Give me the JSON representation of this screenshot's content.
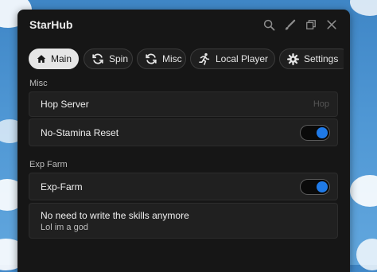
{
  "window": {
    "title": "StarHub"
  },
  "tabs": [
    {
      "label": "Main",
      "icon": "home-icon",
      "active": true
    },
    {
      "label": "Spin",
      "icon": "refresh-icon",
      "active": false
    },
    {
      "label": "Misc",
      "icon": "refresh-icon",
      "active": false
    },
    {
      "label": "Local Player",
      "icon": "running-person-icon",
      "active": false
    },
    {
      "label": "Settings",
      "icon": "gear-icon",
      "active": false
    }
  ],
  "sections": {
    "misc": {
      "label": "Misc",
      "hop_server": {
        "label": "Hop Server",
        "hint": "Hop"
      },
      "no_stamina": {
        "label": "No-Stamina Reset",
        "enabled": true
      }
    },
    "exp_farm": {
      "label": "Exp Farm",
      "exp_farm_toggle": {
        "label": "Exp-Farm",
        "enabled": true
      },
      "paragraph": {
        "title": "No need to write the skills anymore",
        "content": "Lol im a god"
      }
    }
  },
  "colors": {
    "accent": "#1f7ae8",
    "window_bg": "#161616",
    "row_bg": "#202020"
  }
}
